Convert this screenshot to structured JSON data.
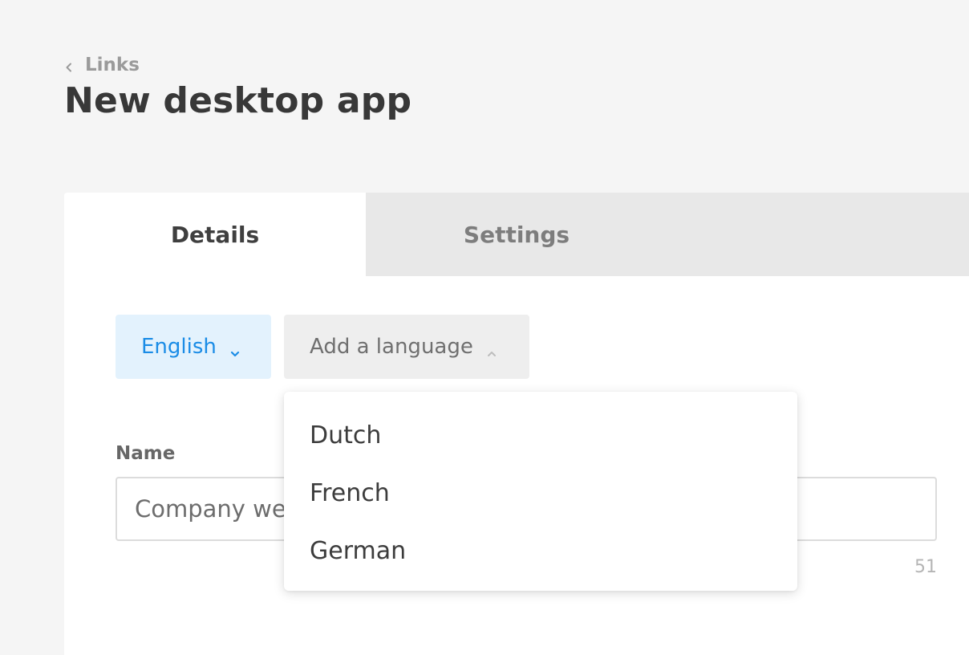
{
  "breadcrumb": {
    "label": "Links",
    "icon": "chevron-left-icon"
  },
  "page": {
    "title": "New desktop app"
  },
  "tabs": [
    {
      "label": "Details",
      "active": true
    },
    {
      "label": "Settings",
      "active": false
    }
  ],
  "languages": {
    "current": {
      "label": "English",
      "icon": "chevron-down-icon"
    },
    "add": {
      "label": "Add a language",
      "icon": "chevron-up-icon"
    },
    "options": [
      "Dutch",
      "French",
      "German"
    ]
  },
  "form": {
    "name": {
      "label": "Name",
      "value": "Company website",
      "char_count": "51"
    }
  },
  "colors": {
    "background": "#f5f5f5",
    "accent": "#1a8ce6",
    "accent_bg": "#e3f2fd",
    "tab_inactive_bg": "#e8e8e8"
  }
}
